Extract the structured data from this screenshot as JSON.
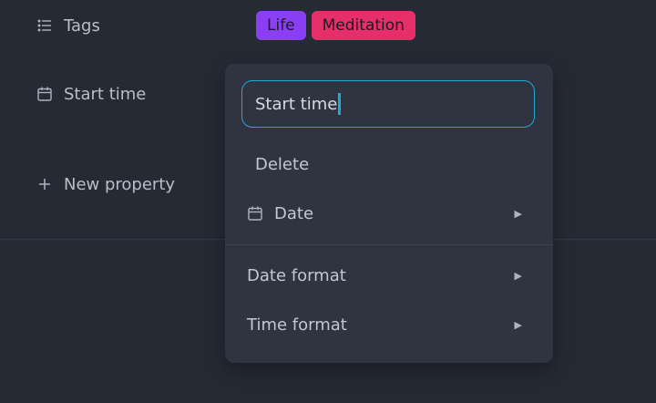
{
  "properties": {
    "tags_label": "Tags",
    "start_time_label": "Start time",
    "new_property_label": "New property"
  },
  "tags": [
    {
      "label": "Life",
      "color": "#8b3ff5"
    },
    {
      "label": "Meditation",
      "color": "#e62e6a"
    }
  ],
  "popup": {
    "name_value": "Start time",
    "delete_label": "Delete",
    "type_label": "Date",
    "date_format_label": "Date format",
    "time_format_label": "Time format"
  },
  "colors": {
    "background": "#262a35",
    "popup_bg": "#2f3440",
    "accent": "#22a8d6"
  }
}
